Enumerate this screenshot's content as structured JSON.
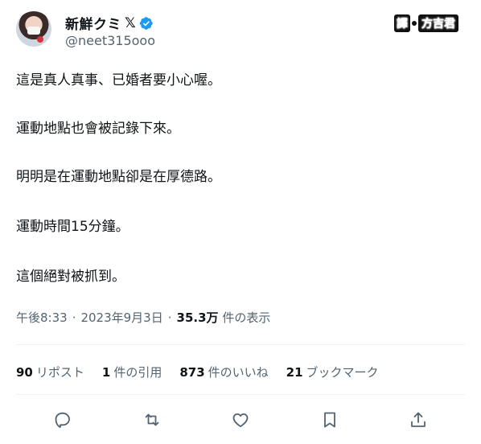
{
  "author": {
    "display_name": "新鮮クミ",
    "x_badge": "𝕏",
    "handle": "@neet315ooo"
  },
  "translator": {
    "tag": "譯",
    "name": "方吉君"
  },
  "post": {
    "paragraphs": [
      "這是真人真事、已婚者要小心喔。",
      "運動地點也會被記錄下來。",
      "明明是在運動地點卻是在厚德路。",
      "運動時間15分鐘。",
      "這個絕對被抓到。"
    ]
  },
  "meta": {
    "time": "午後8:33",
    "sep1": "·",
    "date": "2023年9月3日",
    "sep2": "·",
    "views_count": "35.3万",
    "views_label": "件の表示"
  },
  "stats": {
    "reposts_count": "90",
    "reposts_label": "リポスト",
    "quotes_count": "1",
    "quotes_label": "件の引用",
    "likes_count": "873",
    "likes_label": "件のいいね",
    "bookmarks_count": "21",
    "bookmarks_label": "ブックマーク"
  },
  "colors": {
    "text": "#0f1419",
    "secondary": "#536471",
    "verified": "#1d9bf0",
    "divider": "#eff3f4"
  },
  "icons": [
    "reply-icon",
    "repost-icon",
    "like-icon",
    "bookmark-icon",
    "share-icon",
    "verified-icon"
  ]
}
